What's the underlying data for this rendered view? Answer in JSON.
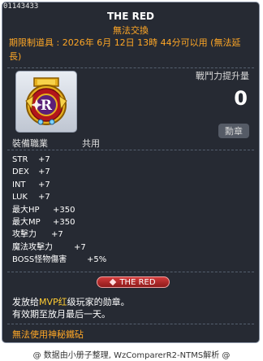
{
  "item_id": "01143433",
  "item_name": "THE RED",
  "trade_restriction": "無法交換",
  "expiry": {
    "prefix": "期限制道具 :",
    "text": "2026年 6月 12日 13時 44分可以用 (無法延長)"
  },
  "icon": {
    "name": "red-medal-icon",
    "letter": "R",
    "colors": {
      "gold": "#e6b01e",
      "red": "#b3151b",
      "purple": "#5b1f78"
    }
  },
  "combat_power": {
    "label": "戰鬥力提升量",
    "value": "0"
  },
  "category_tag": "勳章",
  "job": {
    "label": "裝備職業",
    "value": "共用"
  },
  "stats": [
    {
      "name": "STR",
      "value": "+7"
    },
    {
      "name": "DEX",
      "value": "+7"
    },
    {
      "name": "INT",
      "value": "+7"
    },
    {
      "name": "LUK",
      "value": "+7"
    },
    {
      "name": "最大HP",
      "value": "+350"
    },
    {
      "name": "最大MP",
      "value": "+350"
    },
    {
      "name": "攻擊力",
      "value": "+7"
    },
    {
      "name": "魔法攻擊力",
      "value": "+7"
    },
    {
      "name": "BOSS怪物傷害",
      "value": "+5%"
    }
  ],
  "badge_label": "THE RED",
  "description": {
    "line1_pre": "发放给",
    "line1_highlight": "MVP红",
    "line1_post": "级玩家的勋章。",
    "line2": "有效期至放月最后一天。"
  },
  "gem_notice": "無法使用神秘鐵砧",
  "footer": "@ 数据由小册子整理, WzComparerR2-NTMS解析 @",
  "colors": {
    "background": "#262a33",
    "border": "#8d97a8",
    "orange": "#ffa726",
    "highlight": "#ffcc33",
    "badge_red": "#b3151b"
  }
}
